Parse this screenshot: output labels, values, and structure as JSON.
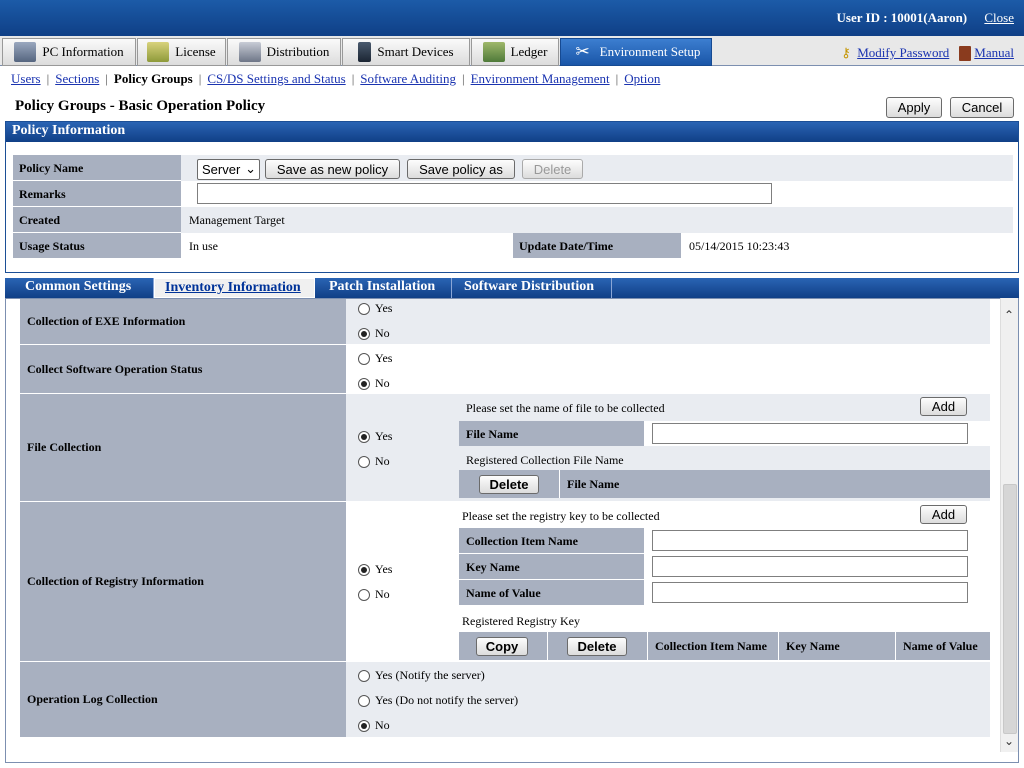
{
  "header": {
    "user_label": "User ID : 10001(Aaron)",
    "close_label": "Close"
  },
  "menu": {
    "tabs": [
      {
        "label": "PC Information"
      },
      {
        "label": "License"
      },
      {
        "label": "Distribution"
      },
      {
        "label": "Smart Devices"
      },
      {
        "label": "Ledger"
      },
      {
        "label": "Environment Setup"
      }
    ],
    "modify_password": "Modify Password",
    "manual": "Manual"
  },
  "subnav": {
    "items": [
      {
        "label": "Users"
      },
      {
        "label": "Sections"
      },
      {
        "label": "Policy Groups"
      },
      {
        "label": "CS/DS Settings and Status"
      },
      {
        "label": "Software Auditing"
      },
      {
        "label": "Environment Management"
      },
      {
        "label": "Option"
      }
    ]
  },
  "page": {
    "title": "Policy Groups - Basic Operation Policy",
    "apply_label": "Apply",
    "cancel_label": "Cancel"
  },
  "policy_info": {
    "heading": "Policy Information",
    "policy_name_label": "Policy Name",
    "policy_name_value": "Server",
    "save_new_label": "Save as new policy",
    "save_as_label": "Save policy as",
    "delete_label": "Delete",
    "remarks_label": "Remarks",
    "remarks_value": "",
    "created_label": "Created",
    "created_value": "Management Target",
    "usage_label": "Usage Status",
    "usage_value": "In use",
    "update_label": "Update Date/Time",
    "update_value": "05/14/2015 10:23:43"
  },
  "tabs": {
    "items": [
      {
        "label": "Common Settings"
      },
      {
        "label": "Inventory Information"
      },
      {
        "label": "Patch Installation"
      },
      {
        "label": "Software Distribution"
      }
    ],
    "active_index": 1
  },
  "settings": {
    "yes": "Yes",
    "no": "No",
    "exe": {
      "label": "Collection of EXE Information",
      "selected": "No"
    },
    "sw_status": {
      "label": "Collect Software Operation Status",
      "selected": "No"
    },
    "file_collection": {
      "label": "File Collection",
      "selected": "Yes",
      "hint": "Please set the name of file to be collected",
      "add_label": "Add",
      "file_name_label": "File Name",
      "file_name_value": "",
      "registered_label": "Registered Collection File Name",
      "delete_label": "Delete",
      "col_file_name": "File Name"
    },
    "registry": {
      "label": "Collection of Registry Information",
      "selected": "Yes",
      "hint": "Please set the registry key to be collected",
      "add_label": "Add",
      "item_name_label": "Collection Item Name",
      "key_name_label": "Key Name",
      "value_name_label": "Name of Value",
      "registered_label": "Registered Registry Key",
      "copy_label": "Copy",
      "delete_label": "Delete",
      "col_item_name": "Collection Item Name",
      "col_key_name": "Key Name",
      "col_value_name": "Name of Value"
    },
    "op_log": {
      "label": "Operation Log Collection",
      "opt_notify": "Yes (Notify the server)",
      "opt_no_notify": "Yes (Do not notify the server)",
      "opt_no": "No",
      "selected": "No"
    }
  }
}
